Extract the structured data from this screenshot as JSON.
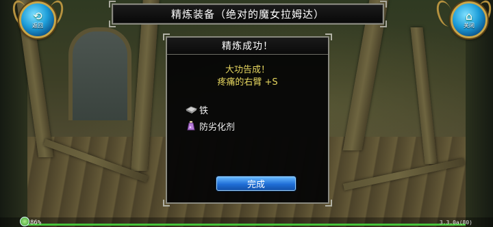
{
  "header": {
    "title": "精炼装备（绝对的魔女拉姆达）",
    "back_button": {
      "label": "返回",
      "icon": "back-arrow-icon"
    },
    "close_button": {
      "label": "关闭",
      "icon": "home-icon"
    }
  },
  "dialog": {
    "title": "精炼成功！",
    "message_line1": "大功告成！",
    "message_line2": "疼痛的右臂 +S",
    "materials": [
      {
        "label": "铁",
        "icon": "iron-ingot-icon"
      },
      {
        "label": "防劣化剂",
        "icon": "potion-bottle-icon"
      }
    ],
    "done_button": "完成"
  },
  "status": {
    "battery": "86%",
    "version": "3.3.0a(80)"
  },
  "colors": {
    "message_yellow": "#e8d860",
    "button_blue": "#1f6ed6",
    "exp_green": "#46c23a",
    "frame_gold": "#c9a64a"
  }
}
